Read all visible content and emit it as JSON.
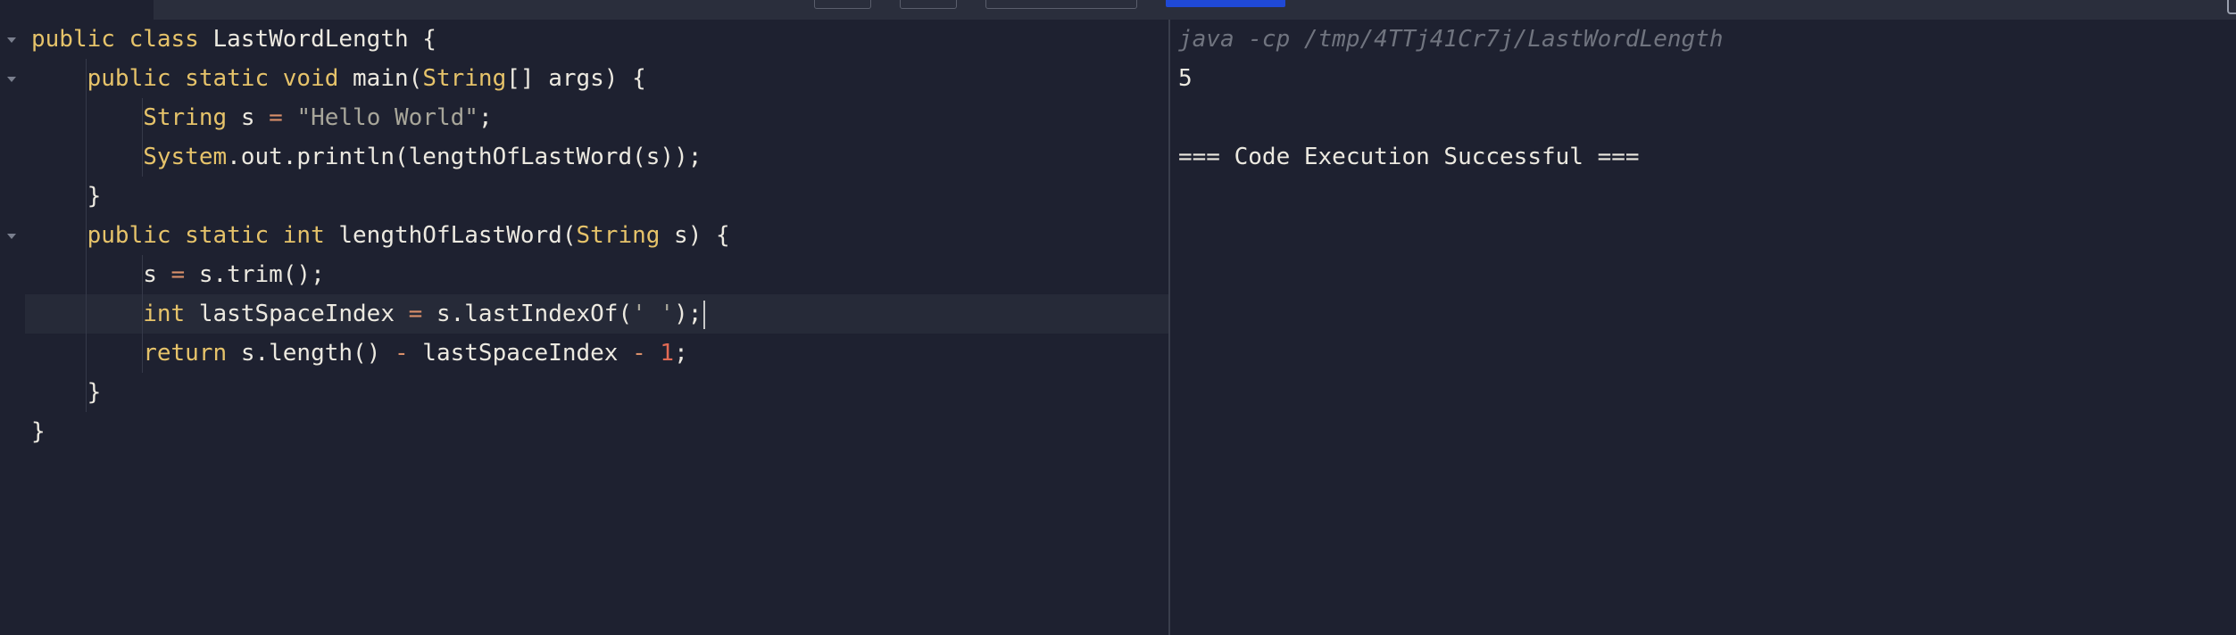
{
  "editor": {
    "lines": [
      [
        {
          "t": "public class ",
          "c": "kw"
        },
        {
          "t": "LastWordLength {",
          "c": ""
        }
      ],
      [
        {
          "t": "    public static void ",
          "c": "kw"
        },
        {
          "t": "main(",
          "c": ""
        },
        {
          "t": "String",
          "c": "kw"
        },
        {
          "t": "[] args) {",
          "c": ""
        }
      ],
      [
        {
          "t": "        String ",
          "c": "kw"
        },
        {
          "t": "s ",
          "c": ""
        },
        {
          "t": "=",
          "c": "op"
        },
        {
          "t": " ",
          "c": ""
        },
        {
          "t": "\"Hello World\"",
          "c": "str"
        },
        {
          "t": ";",
          "c": ""
        }
      ],
      [
        {
          "t": "        System",
          "c": "kw"
        },
        {
          "t": ".out.println(lengthOfLastWord(s));",
          "c": ""
        }
      ],
      [
        {
          "t": "    }",
          "c": ""
        }
      ],
      [
        {
          "t": "    public static int ",
          "c": "kw"
        },
        {
          "t": "lengthOfLastWord(",
          "c": ""
        },
        {
          "t": "String",
          "c": "kw"
        },
        {
          "t": " s) {",
          "c": ""
        }
      ],
      [
        {
          "t": "        s ",
          "c": ""
        },
        {
          "t": "=",
          "c": "op"
        },
        {
          "t": " s.trim();",
          "c": ""
        }
      ],
      [
        {
          "t": "        int ",
          "c": "kw"
        },
        {
          "t": "lastSpaceIndex ",
          "c": ""
        },
        {
          "t": "=",
          "c": "op"
        },
        {
          "t": " s.lastIndexOf(",
          "c": ""
        },
        {
          "t": "' '",
          "c": "str"
        },
        {
          "t": ");",
          "c": ""
        }
      ],
      [
        {
          "t": "        return ",
          "c": "kw"
        },
        {
          "t": "s.length() ",
          "c": ""
        },
        {
          "t": "-",
          "c": "op"
        },
        {
          "t": " lastSpaceIndex ",
          "c": ""
        },
        {
          "t": "-",
          "c": "op"
        },
        {
          "t": " ",
          "c": ""
        },
        {
          "t": "1",
          "c": "num"
        },
        {
          "t": ";",
          "c": ""
        }
      ],
      [
        {
          "t": "    }",
          "c": ""
        }
      ],
      [
        {
          "t": "}",
          "c": ""
        }
      ]
    ],
    "fold_lines": [
      0,
      1,
      5
    ],
    "active_line": 7
  },
  "output": {
    "command": "java -cp /tmp/4TTj41Cr7j/LastWordLength",
    "result": "5",
    "status": "=== Code Execution Successful ==="
  },
  "colors": {
    "background": "#1e2130",
    "keyword": "#e6c36a",
    "string": "#a8a69a",
    "operator": "#d98f6a",
    "number": "#e26a54",
    "run_button": "#1f49d6"
  }
}
